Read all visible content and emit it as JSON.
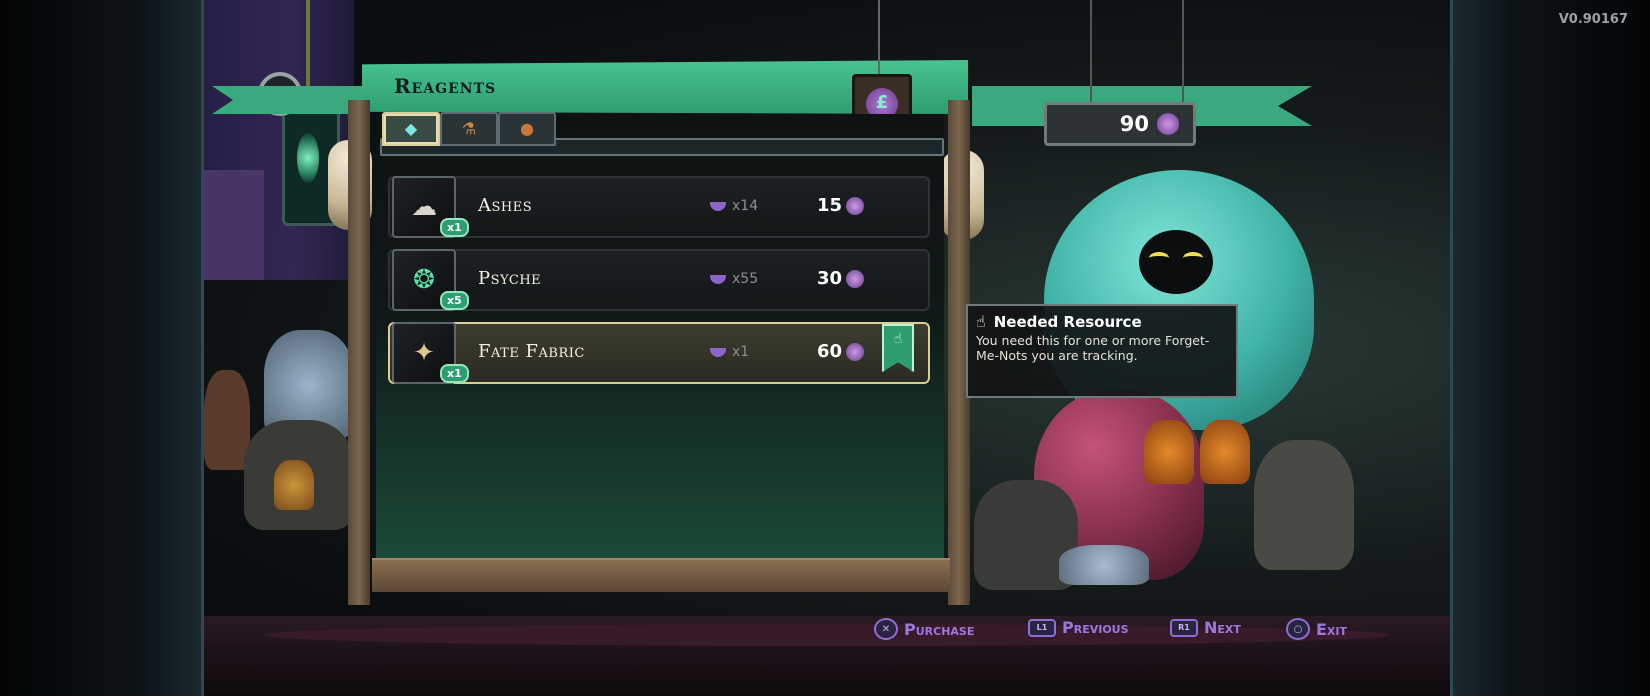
{
  "version": "V0.90167",
  "shop": {
    "title": "Reagents",
    "tabs": [
      {
        "icon": "gem-icon",
        "glyph": "◆",
        "active": true
      },
      {
        "icon": "bottle-icon",
        "glyph": "⚗",
        "active": false
      },
      {
        "icon": "bag-icon",
        "glyph": "●",
        "active": false
      }
    ]
  },
  "currency": {
    "value": "90",
    "icon": "moon-coin-icon"
  },
  "items": [
    {
      "name": "Ashes",
      "qty": "x1",
      "owned": "x14",
      "price": "15",
      "icon": "ashes-icon",
      "selected": false,
      "tracked": false
    },
    {
      "name": "Psyche",
      "qty": "x5",
      "owned": "x55",
      "price": "30",
      "icon": "psyche-icon",
      "selected": false,
      "tracked": false
    },
    {
      "name": "Fate Fabric",
      "qty": "x1",
      "owned": "x1",
      "price": "60",
      "icon": "fate-fabric-icon",
      "selected": true,
      "tracked": true
    }
  ],
  "tooltip": {
    "title": "Needed Resource",
    "body": "You need this for one or more Forget-Me-Nots you are tracking."
  },
  "prompts": {
    "purchase": "Purchase",
    "previous": "Previous",
    "next": "Next",
    "exit": "Exit",
    "purchase_btn": "✕",
    "previous_btn": "L1",
    "next_btn": "R1",
    "exit_btn": "○"
  },
  "colors": {
    "accent_green": "#2f9d70",
    "prompt_purple": "#9c78de",
    "selected_border": "#d8cf94"
  }
}
